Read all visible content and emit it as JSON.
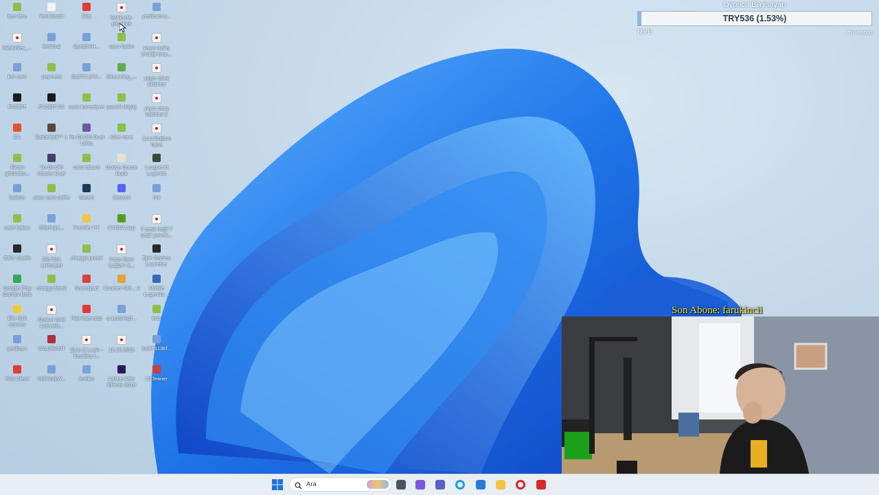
{
  "desktop": {
    "icons": [
      {
        "label": "ben fero",
        "icon": "image-file-icon",
        "color": "#8fbf4a"
      },
      {
        "label": "Yeni klasör",
        "icon": "folder-icon",
        "color": "#f3f3f3"
      },
      {
        "label": "Blitz",
        "icon": "blitz-app-icon",
        "color": "#e03a3a"
      },
      {
        "label": "taskinefe- pitchkick",
        "icon": "recording-file-icon",
        "color": "#f5f5f5"
      },
      {
        "label": "yesilcam-o...",
        "icon": "document-icon",
        "color": "#7aa0d8"
      },
      {
        "label": "bizimkiler_...",
        "icon": "recording-file-icon",
        "color": "#f5f5f5"
      },
      {
        "label": "feritiko2",
        "icon": "document-icon",
        "color": "#7aa0d8"
      },
      {
        "label": "Gyt1DKH...",
        "icon": "document-icon",
        "color": "#7aa0d8"
      },
      {
        "label": "cavs kadın",
        "icon": "image-file-icon",
        "color": "#8fbf4a"
      },
      {
        "label": "yayın açılış müziği loop...",
        "icon": "recording-file-icon",
        "color": "#f5f5f5"
      },
      {
        "label": "kel cavs",
        "icon": "document-icon",
        "color": "#7aa0d8"
      },
      {
        "label": "payment",
        "icon": "image-file-icon",
        "color": "#8fbf4a"
      },
      {
        "label": "Gz3TC1PX...",
        "icon": "document-icon",
        "color": "#7aa0d8"
      },
      {
        "label": "Streamlog_...",
        "icon": "streamlog-icon",
        "color": "#6aa84f"
      },
      {
        "label": "yayın story bildirimi",
        "icon": "recording-file-icon",
        "color": "#f5f5f5"
      },
      {
        "label": "FACEIT",
        "icon": "faceit-icon",
        "color": "#1b1b1b"
      },
      {
        "label": "FACEIT AC",
        "icon": "faceit-ac-icon",
        "color": "#1b1b1b"
      },
      {
        "label": "cavs komedyen",
        "icon": "image-file-icon",
        "color": "#8fbf4a"
      },
      {
        "label": "şuanki düşüş",
        "icon": "image-file-icon",
        "color": "#8fbf4a"
      },
      {
        "label": "yayın story bildirimi 2",
        "icon": "recording-file-icon",
        "color": "#f5f5f5"
      },
      {
        "label": "EA",
        "icon": "ea-icon",
        "color": "#e8522b"
      },
      {
        "label": "Battlefield™ 1",
        "icon": "battlefield-icon",
        "color": "#5a4636"
      },
      {
        "label": "Yu-Gi-Oh! Duel Links",
        "icon": "yugioh-duel-links-icon",
        "color": "#6a5a9a"
      },
      {
        "label": "cüce cavs",
        "icon": "image-file-icon",
        "color": "#8fbf4a"
      },
      {
        "label": "Çocukluğum haha",
        "icon": "recording-file-icon",
        "color": "#f5f5f5"
      },
      {
        "label": "Ekran görüntüs...",
        "icon": "image-file-icon",
        "color": "#8fbf4a"
      },
      {
        "label": "Yu-Gi-Oh! Master Duel",
        "icon": "yugioh-master-duel-icon",
        "color": "#4a3a6a"
      },
      {
        "label": "cavs tabure",
        "icon": "image-file-icon",
        "color": "#8fbf4a"
      },
      {
        "label": "Goose Goose Duck",
        "icon": "goose-goose-duck-icon",
        "color": "#e6e0d0"
      },
      {
        "label": "League of Legends",
        "icon": "league-of-legends-icon",
        "color": "#3d4a3a"
      },
      {
        "label": "bakma",
        "icon": "document-icon",
        "color": "#7aa0d8"
      },
      {
        "label": "cüce cavs selfie",
        "icon": "image-file-icon",
        "color": "#8fbf4a"
      },
      {
        "label": "Steam",
        "icon": "steam-icon",
        "color": "#1b3b5a"
      },
      {
        "label": "Discord",
        "icon": "discord-icon",
        "color": "#5865f2"
      },
      {
        "label": "riot",
        "icon": "document-icon",
        "color": "#7aa0d8"
      },
      {
        "label": "cavs bakan",
        "icon": "image-file-icon",
        "color": "#8fbf4a"
      },
      {
        "label": "GfbrlngX...",
        "icon": "document-icon",
        "color": "#7aa0d8"
      },
      {
        "label": "Premier PF",
        "icon": "folder-icon",
        "color": "#f2c744"
      },
      {
        "label": "NVIDIA App",
        "icon": "nvidia-icon",
        "color": "#5a9a1a"
      },
      {
        "label": "5 çeşit değil 7 çeşit yemek...",
        "icon": "recording-file-icon",
        "color": "#f5f5f5"
      },
      {
        "label": "OBS Studio",
        "icon": "obs-icon",
        "color": "#2a2a2a"
      },
      {
        "label": "Efe kick animated",
        "icon": "recording-file-icon",
        "color": "#f5f5f5"
      },
      {
        "label": "chatgpt promt",
        "icon": "image-file-icon",
        "color": "#8fbf4a"
      },
      {
        "label": "Cavs Alper Çağlar'ı Z...",
        "icon": "recording-file-icon",
        "color": "#f5f5f5"
      },
      {
        "label": "Epic Games Launcher",
        "icon": "epic-games-icon",
        "color": "#2a2a2a"
      },
      {
        "label": "Google Play Games Beta",
        "icon": "google-play-games-icon",
        "color": "#34a853"
      },
      {
        "label": "chatgpt foto2",
        "icon": "image-file-icon",
        "color": "#8fbf4a"
      },
      {
        "label": "Soundpad",
        "icon": "soundpad-icon",
        "color": "#d94040"
      },
      {
        "label": "Counter-Stri... 2",
        "icon": "counter-strike-icon",
        "color": "#e8a23a"
      },
      {
        "label": "Mobile Legends:...",
        "icon": "mobile-legends-icon",
        "color": "#3a6ab8"
      },
      {
        "label": "Efe Kick emotes",
        "icon": "folder-icon",
        "color": "#f2c744"
      },
      {
        "label": "Outrun Grid Animatio...",
        "icon": "recording-file-icon",
        "color": "#f5f5f5"
      },
      {
        "label": "Riot İstemcisi",
        "icon": "riot-client-icon",
        "color": "#e03a3a"
      },
      {
        "label": "s-1c69462f...",
        "icon": "document-icon",
        "color": "#7aa0d8"
      },
      {
        "label": "kcip",
        "icon": "image-file-icon",
        "color": "#8fbf4a"
      },
      {
        "label": "yesilcam",
        "icon": "document-icon",
        "color": "#7aa0d8"
      },
      {
        "label": "VALORANT",
        "icon": "valorant-icon",
        "color": "#b0303a"
      },
      {
        "label": "Şam & Laçin - Kendine l...",
        "icon": "recording-file-icon",
        "color": "#f5f5f5"
      },
      {
        "label": "16.10.2025",
        "icon": "recording-file-icon",
        "color": "#f5f5f5"
      },
      {
        "label": "2c9f75136f...",
        "icon": "document-icon",
        "color": "#7aa0d8"
      },
      {
        "label": "Riot Client",
        "icon": "riot-client-icon",
        "color": "#e03a3a"
      },
      {
        "label": "DbFduhjW...",
        "icon": "document-icon",
        "color": "#7aa0d8"
      },
      {
        "label": "feritiko",
        "icon": "document-icon",
        "color": "#7aa0d8"
      },
      {
        "label": "Adobe After Effects 2019",
        "icon": "after-effects-icon",
        "color": "#2a1a5a"
      },
      {
        "label": "CCleaner",
        "icon": "ccleaner-icon",
        "color": "#c84040"
      }
    ]
  },
  "stats_overlay": {
    "title": "Oyuncu Bilgisayarı",
    "progress_label": "TRY536 (1.53%)",
    "progress_fraction": 0.0153,
    "min_label": "RY0",
    "max_label": "TRY35000",
    "fill_color": "#8fb8df"
  },
  "stream_overlay": {
    "last_subscriber": "Son Abone: farukincii"
  },
  "taskbar": {
    "search_placeholder": "Ara",
    "apps": [
      {
        "name": "start-icon",
        "color": "#1a73d8"
      },
      {
        "name": "task-view-icon",
        "color": "#4a5560"
      },
      {
        "name": "copilot-icon",
        "color": "#7a5ae0"
      },
      {
        "name": "teams-icon",
        "color": "#5b5fc7"
      },
      {
        "name": "edge-icon",
        "color": "#1fa0d8"
      },
      {
        "name": "store-icon",
        "color": "#2a7ad8"
      },
      {
        "name": "file-explorer-icon",
        "color": "#f2c744"
      },
      {
        "name": "opera-icon",
        "color": "#e0202a"
      },
      {
        "name": "wps-icon",
        "color": "#d92a2a"
      }
    ]
  }
}
